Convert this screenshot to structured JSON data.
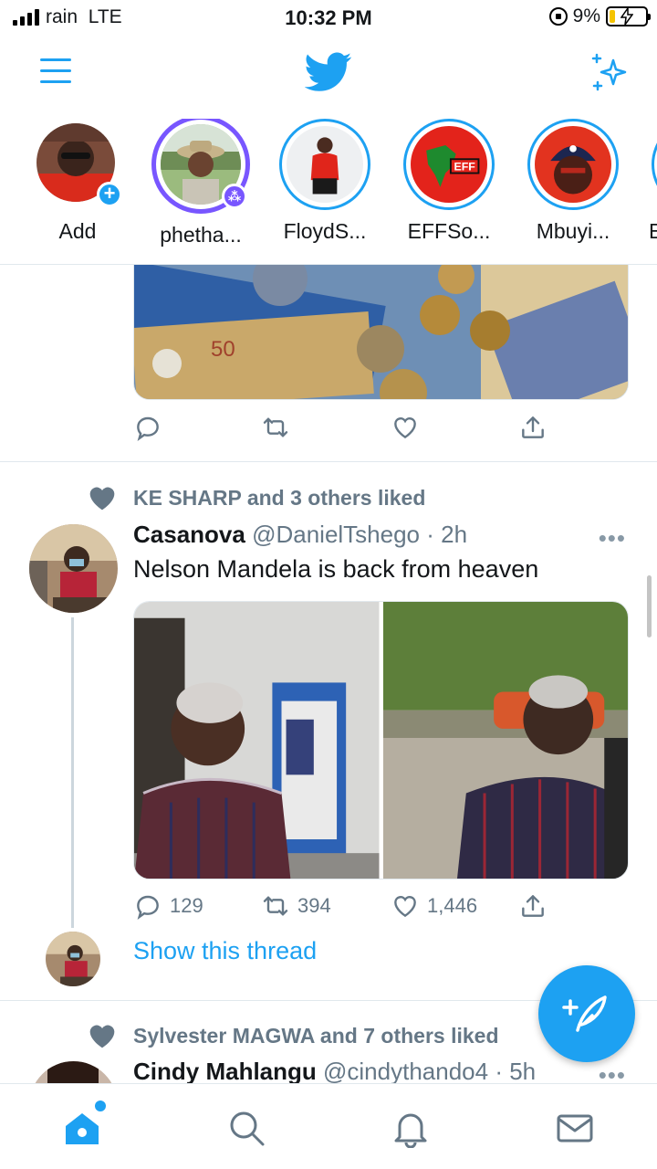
{
  "status_bar": {
    "carrier": "rain",
    "network": "LTE",
    "time": "10:32 PM",
    "battery_percent": "9%"
  },
  "header": {
    "menu_icon": "menu-icon",
    "logo_icon": "twitter-bird-icon",
    "sparkle_icon": "sparkle-icon",
    "accent_color": "#1da1f2"
  },
  "fleets": [
    {
      "name": "Add"
    },
    {
      "name": "phetha..."
    },
    {
      "name": "FloydS..."
    },
    {
      "name": "EFFSo..."
    },
    {
      "name": "Mbuyi..."
    },
    {
      "name": "E"
    }
  ],
  "fleet_logo_text": "EFF",
  "tweet1": {
    "reply_icon": "reply-icon",
    "retweet_icon": "retweet-icon",
    "like_icon": "like-icon",
    "share_icon": "share-icon"
  },
  "tweet2": {
    "social_context": "KE SHARP and 3 others liked",
    "name": "Casanova",
    "handle": "@DanielTshego",
    "time": "· 2h",
    "text": "Nelson Mandela is back from heaven",
    "replies": "129",
    "retweets": "394",
    "likes": "1,446",
    "show_thread": "Show this thread"
  },
  "tweet3": {
    "social_context": "Sylvester MAGWA and 7 others liked",
    "name": "Cindy Mahlangu",
    "handle": "@cindythando4",
    "time": "· 5h"
  },
  "more_label": "•••",
  "tabbar": {
    "items": [
      "home-icon",
      "search-icon",
      "notifications-icon",
      "messages-icon"
    ]
  }
}
